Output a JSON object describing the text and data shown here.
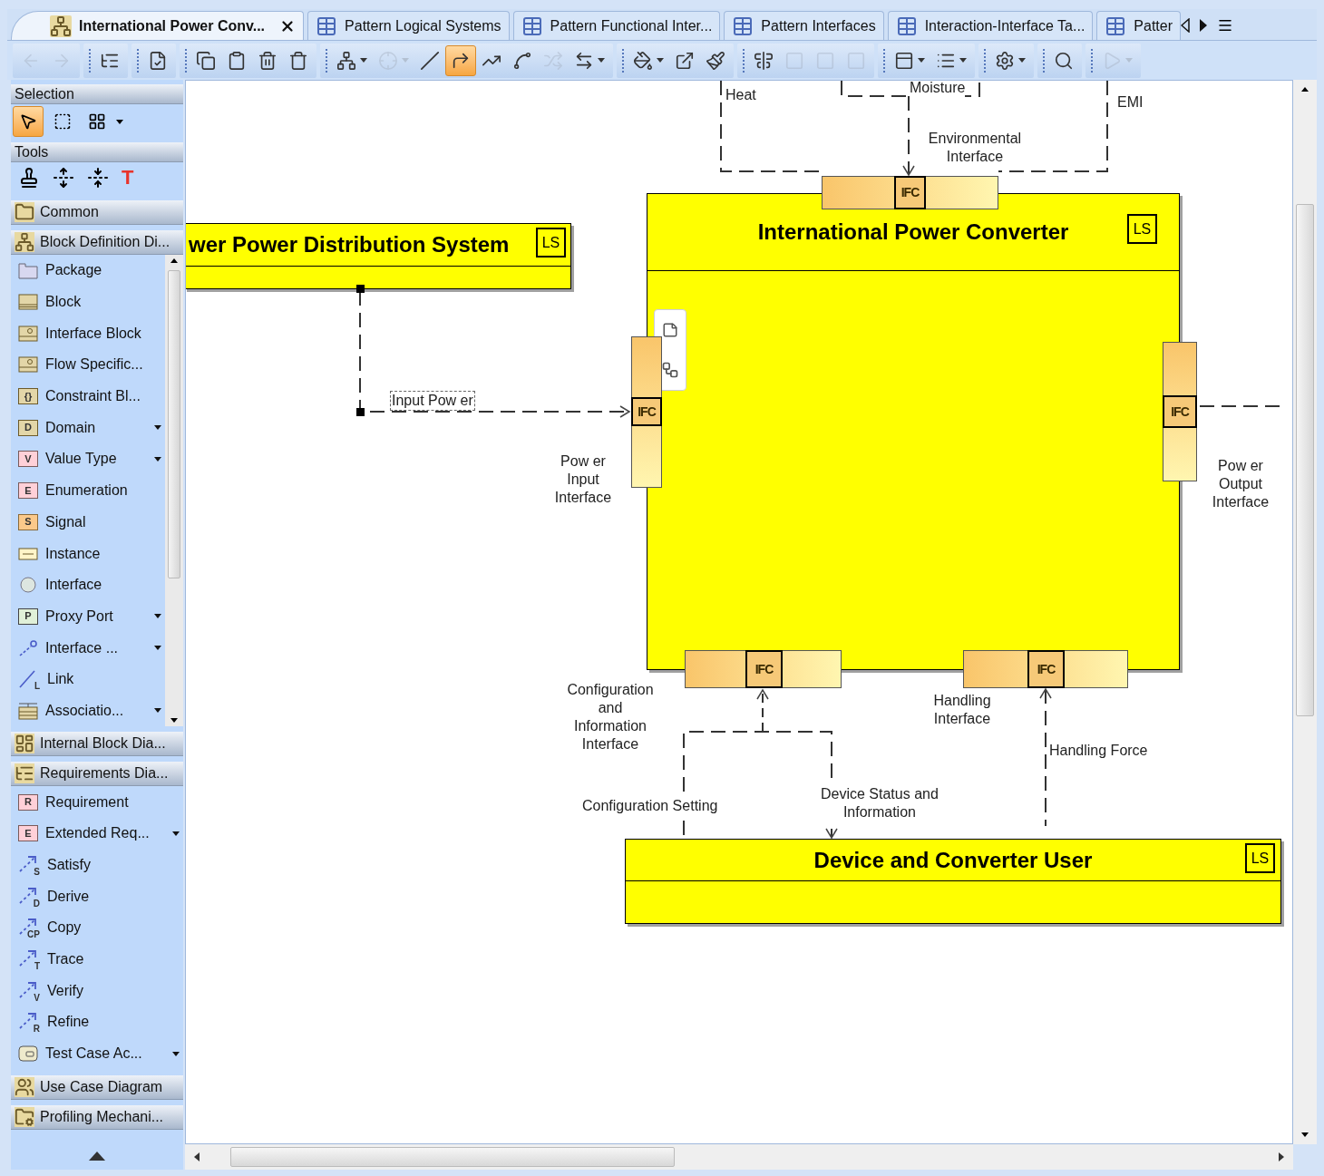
{
  "tabs": [
    {
      "label": "International Power Conv...",
      "kind": "diagram",
      "selected": true,
      "closable": true
    },
    {
      "label": "Pattern Logical Systems",
      "kind": "table",
      "selected": false,
      "closable": false
    },
    {
      "label": "Pattern Functional Inter...",
      "kind": "table",
      "selected": false,
      "closable": false
    },
    {
      "label": "Pattern Interfaces",
      "kind": "table",
      "selected": false,
      "closable": false
    },
    {
      "label": "Interaction-Interface Ta...",
      "kind": "table",
      "selected": false,
      "closable": false
    },
    {
      "label": "Patter",
      "kind": "table",
      "selected": false,
      "closable": false
    }
  ],
  "toolbar": [
    [
      {
        "kind": "back",
        "selected": false,
        "disabled": true,
        "dropdown": false
      },
      {
        "kind": "forward",
        "selected": false,
        "disabled": true,
        "dropdown": false
      }
    ],
    [
      {
        "kind": "containment",
        "selected": false,
        "disabled": false,
        "dropdown": false
      }
    ],
    [
      {
        "kind": "validate",
        "selected": false,
        "disabled": false,
        "dropdown": false
      }
    ],
    [
      {
        "kind": "copy",
        "selected": false,
        "disabled": false,
        "dropdown": false
      },
      {
        "kind": "paste",
        "selected": false,
        "disabled": false,
        "dropdown": false
      },
      {
        "kind": "delete",
        "selected": false,
        "disabled": false,
        "dropdown": false
      },
      {
        "kind": "delete-symbol",
        "selected": false,
        "disabled": false,
        "dropdown": false
      }
    ],
    [
      {
        "kind": "hierarchy",
        "selected": false,
        "disabled": false,
        "dropdown": true
      },
      {
        "kind": "split",
        "selected": false,
        "disabled": true,
        "dropdown": true
      },
      {
        "kind": "line",
        "selected": false,
        "disabled": false,
        "dropdown": false
      },
      {
        "kind": "orthogonal",
        "selected": true,
        "disabled": false,
        "dropdown": false
      },
      {
        "kind": "diagonal",
        "selected": false,
        "disabled": false,
        "dropdown": false
      },
      {
        "kind": "curve",
        "selected": false,
        "disabled": false,
        "dropdown": false
      },
      {
        "kind": "reroute",
        "selected": false,
        "disabled": true,
        "dropdown": false
      },
      {
        "kind": "swap",
        "selected": false,
        "disabled": false,
        "dropdown": true
      }
    ],
    [
      {
        "kind": "fill",
        "selected": false,
        "disabled": false,
        "dropdown": true
      },
      {
        "kind": "export",
        "selected": false,
        "disabled": false,
        "dropdown": false
      },
      {
        "kind": "brush",
        "selected": false,
        "disabled": false,
        "dropdown": false
      }
    ],
    [
      {
        "kind": "align",
        "selected": false,
        "disabled": false,
        "dropdown": false
      },
      {
        "kind": "shape",
        "selected": false,
        "disabled": true,
        "dropdown": false
      },
      {
        "kind": "shape",
        "selected": false,
        "disabled": true,
        "dropdown": false
      },
      {
        "kind": "shape",
        "selected": false,
        "disabled": true,
        "dropdown": false
      }
    ],
    [
      {
        "kind": "layout",
        "selected": false,
        "disabled": false,
        "dropdown": true
      },
      {
        "kind": "list",
        "selected": false,
        "disabled": false,
        "dropdown": true
      }
    ],
    [
      {
        "kind": "gear",
        "selected": false,
        "disabled": false,
        "dropdown": true
      }
    ],
    [
      {
        "kind": "search",
        "selected": false,
        "disabled": false,
        "dropdown": false
      }
    ],
    [
      {
        "kind": "play",
        "selected": false,
        "disabled": true,
        "dropdown": true
      }
    ]
  ],
  "palette": {
    "selection": {
      "title": "Selection",
      "tools": [
        {
          "kind": "pointer",
          "selected": true
        },
        {
          "kind": "marquee",
          "selected": false
        },
        {
          "kind": "group-select",
          "selected": false
        }
      ]
    },
    "tools": {
      "title": "Tools",
      "items": [
        {
          "kind": "stamp"
        },
        {
          "kind": "spread"
        },
        {
          "kind": "squeeze"
        },
        {
          "kind": "text",
          "glyph": "T"
        }
      ]
    },
    "groups": [
      {
        "title": "Common",
        "kind": "folder"
      },
      {
        "title": "Block Definition Di...",
        "kind": "bdd",
        "items": [
          {
            "label": "Package",
            "kind": "package",
            "dropdown": false
          },
          {
            "label": "Block",
            "kind": "block",
            "dropdown": false
          },
          {
            "label": "Interface Block",
            "kind": "iface-block",
            "dropdown": false
          },
          {
            "label": "Flow Specific...",
            "kind": "iface-block",
            "dropdown": false
          },
          {
            "label": "Constraint Bl...",
            "kind": "typed",
            "glyph": "{}",
            "dropdown": false
          },
          {
            "label": "Domain",
            "kind": "typed",
            "glyph": "D",
            "dropdown": true
          },
          {
            "label": "Value Type",
            "kind": "value",
            "glyph": "V",
            "dropdown": true
          },
          {
            "label": "Enumeration",
            "kind": "value",
            "glyph": "E",
            "dropdown": false
          },
          {
            "label": "Signal",
            "kind": "signal",
            "glyph": "S",
            "dropdown": false
          },
          {
            "label": "Instance",
            "kind": "instance",
            "dropdown": false
          },
          {
            "label": "Interface",
            "kind": "interface",
            "dropdown": false
          },
          {
            "label": "Proxy Port",
            "kind": "port",
            "glyph": "P",
            "dropdown": true
          },
          {
            "label": "Interface ...",
            "kind": "flow",
            "dropdown": true
          },
          {
            "label": "Link",
            "kind": "link",
            "glyph": "L",
            "dropdown": false
          },
          {
            "label": "Associatio...",
            "kind": "assoc",
            "dropdown": true
          }
        ]
      },
      {
        "title": "Internal Block Dia...",
        "kind": "ibd"
      },
      {
        "title": "Requirements Dia...",
        "kind": "req",
        "items": [
          {
            "label": "Requirement",
            "kind": "value",
            "glyph": "R",
            "dropdown": false
          },
          {
            "label": "Extended Req...",
            "kind": "value",
            "glyph": "E",
            "dropdown": true
          },
          {
            "label": "Satisfy",
            "kind": "relation",
            "glyph": "S",
            "dropdown": false
          },
          {
            "label": "Derive",
            "kind": "relation",
            "glyph": "D",
            "dropdown": false
          },
          {
            "label": "Copy",
            "kind": "relation",
            "glyph": "CP",
            "dropdown": false
          },
          {
            "label": "Trace",
            "kind": "relation",
            "glyph": "T",
            "dropdown": false
          },
          {
            "label": "Verify",
            "kind": "relation",
            "glyph": "V",
            "dropdown": false
          },
          {
            "label": "Refine",
            "kind": "relation",
            "glyph": "R",
            "dropdown": false
          },
          {
            "label": "Test Case Ac...",
            "kind": "testcase",
            "dropdown": true
          }
        ]
      },
      {
        "title": "Use Case Diagram",
        "kind": "usecase"
      },
      {
        "title": "Profiling Mechani...",
        "kind": "profile"
      }
    ]
  },
  "diagram": {
    "blocks": [
      {
        "name": "wer Power Distribution System",
        "stereotype": "LS"
      },
      {
        "name": "International Power Converter",
        "stereotype": "LS"
      },
      {
        "name": "Device and Converter User",
        "stereotype": "LS"
      }
    ],
    "ports": [
      {
        "label": "IFC",
        "kind": "horizontal"
      },
      {
        "label": "IFC",
        "kind": "vertical"
      },
      {
        "label": "IFC",
        "kind": "vertical"
      },
      {
        "label": "IFC",
        "kind": "horizontal"
      },
      {
        "label": "IFC",
        "kind": "horizontal"
      }
    ],
    "port_labels": [
      "Environmental\nInterface",
      "Pow er\nInput\nInterface",
      "Pow er\nOutput\nInterface",
      "Configuration\nand\nInformation\nInterface",
      "Handling\nInterface"
    ],
    "flow_labels": [
      {
        "text": "Heat",
        "selected": false
      },
      {
        "text": "Moisture",
        "selected": false
      },
      {
        "text": "EMI",
        "selected": false
      },
      {
        "text": "Input Pow er",
        "selected": true
      },
      {
        "text": "Handling Force",
        "selected": false
      },
      {
        "text": "Configuration Setting",
        "selected": false
      },
      {
        "text": "Device Status and\nInformation",
        "selected": false
      }
    ]
  }
}
